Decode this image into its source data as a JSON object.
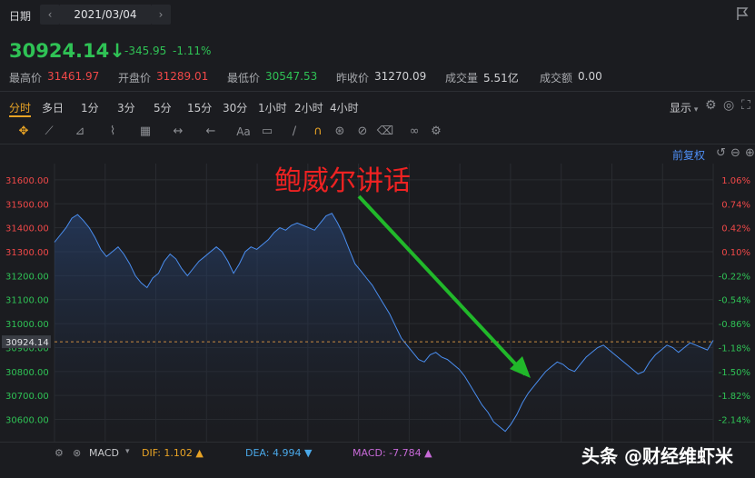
{
  "header": {
    "date_label": "日期",
    "prev_icon": "chevron-left-icon",
    "date_value": "2021/03/04",
    "next_icon": "chevron-right-icon"
  },
  "quote": {
    "price": "30924.14",
    "arrow": "↓",
    "change": "-345.95",
    "change_pct": "-1.11%",
    "stats": [
      {
        "label": "最高价",
        "value": "31461.97",
        "color": "#f04848"
      },
      {
        "label": "开盘价",
        "value": "31289.01",
        "color": "#f04848"
      },
      {
        "label": "最低价",
        "value": "30547.53",
        "color": "#2fc255"
      },
      {
        "label": "昨收价",
        "value": "31270.09",
        "color": "#d0d1d4"
      },
      {
        "label": "成交量",
        "value": "5.51亿",
        "color": "#d0d1d4"
      },
      {
        "label": "成交额",
        "value": "0.00",
        "color": "#d0d1d4"
      }
    ],
    "up_color": "#f04848",
    "down_color": "#2fc255"
  },
  "timeframes": [
    "分时",
    "多日",
    "1分",
    "3分",
    "5分",
    "15分",
    "30分",
    "1小时",
    "2小时",
    "4小时"
  ],
  "display_label": "显示",
  "restore_label": "前复权",
  "annotation": "鲍威尔讲话",
  "watermark": "头条 @财经维虾米",
  "macd": {
    "label": "MACD",
    "dif": "DIF: 1.102 ▲",
    "dea": "DEA: 4.994 ▼",
    "macd": "MACD: -7.784 ▲"
  },
  "chart_data": {
    "type": "area",
    "title": "",
    "prev_close": 31270.09,
    "current": 30924.14,
    "current_label": "30924.14",
    "ylim": [
      30530,
      31630
    ],
    "y_ticks": [
      31600,
      31500,
      31400,
      31300,
      31200,
      31100,
      31000,
      30900,
      30800,
      30700,
      30600
    ],
    "y_tick_labels": [
      "31600.00",
      "31500.00",
      "31400.00",
      "31300.00",
      "31200.00",
      "31100.00",
      "31000.00",
      "30900.00",
      "30800.00",
      "30700.00",
      "30600.00"
    ],
    "pct_labels": [
      "1.06%",
      "0.74%",
      "0.42%",
      "0.10%",
      "-0.22%",
      "-0.54%",
      "-0.86%",
      "-1.18%",
      "-1.50%",
      "-1.82%",
      "-2.14%"
    ],
    "series": [
      {
        "values": [
          31340,
          31370,
          31400,
          31440,
          31455,
          31430,
          31400,
          31360,
          31310,
          31280,
          31300,
          31320,
          31290,
          31250,
          31200,
          31170,
          31150,
          31190,
          31210,
          31260,
          31290,
          31270,
          31230,
          31200,
          31230,
          31260,
          31280,
          31300,
          31320,
          31300,
          31260,
          31210,
          31250,
          31300,
          31320,
          31310,
          31330,
          31350,
          31380,
          31400,
          31390,
          31410,
          31420,
          31410,
          31400,
          31390,
          31420,
          31450,
          31460,
          31420,
          31370,
          31310,
          31250,
          31220,
          31190,
          31160,
          31120,
          31080,
          31040,
          30990,
          30940,
          30910,
          30880,
          30850,
          30840,
          30870,
          30880,
          30860,
          30850,
          30830,
          30810,
          30780,
          30740,
          30700,
          30660,
          30630,
          30590,
          30570,
          30550,
          30580,
          30620,
          30670,
          30710,
          30740,
          30770,
          30800,
          30820,
          30840,
          30830,
          30810,
          30800,
          30830,
          30860,
          30880,
          30900,
          30910,
          30890,
          30870,
          30850,
          30830,
          30810,
          30790,
          30800,
          30840,
          30870,
          30890,
          30910,
          30900,
          30880,
          30900,
          30920,
          30910,
          30900,
          30890,
          30930
        ]
      }
    ],
    "line_color": "#4a8ef0",
    "grid": true
  }
}
